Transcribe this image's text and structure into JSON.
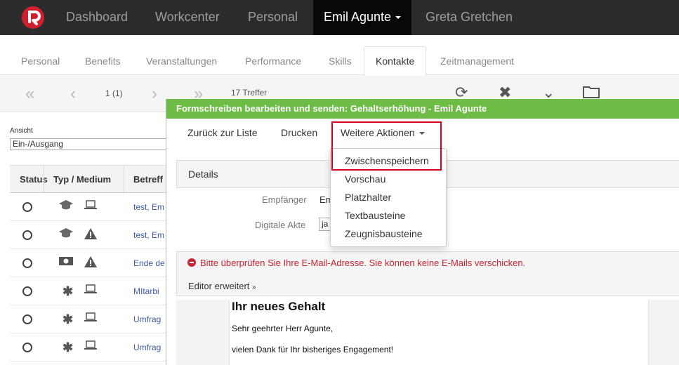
{
  "colors": {
    "topnav_bg": "#2c2c2c",
    "logo": "#d0202e",
    "modal_header": "#6cbc45",
    "error": "#c82333",
    "highlight": "#d9001b",
    "link": "#3b5ba5"
  },
  "topnav": {
    "logo": "logo-icon",
    "items": [
      "Dashboard",
      "Workcenter",
      "Personal",
      "Emil Agunte",
      "Greta Gretchen"
    ]
  },
  "tabs": [
    "Personal",
    "Benefits",
    "Veranstaltungen",
    "Performance",
    "Skills",
    "Kontakte",
    "Zeitmanagement"
  ],
  "pager": {
    "page": "1 (1)",
    "hits": "17 Treffer"
  },
  "sidebar": {
    "view_label": "Ansicht",
    "view_value": "Ein-/Ausgang"
  },
  "table": {
    "headers": [
      "Status",
      "Typ / Medium",
      "Betreff"
    ],
    "rows": [
      {
        "type_icon": "graduation-cap-icon",
        "medium_icon": "laptop-icon",
        "subject": "test, Em"
      },
      {
        "type_icon": "graduation-cap-icon",
        "medium_icon": "warning-icon",
        "subject": "test, Em"
      },
      {
        "type_icon": "money-icon",
        "medium_icon": "warning-icon",
        "subject": "Ende de"
      },
      {
        "type_icon": "asterisk-icon",
        "medium_icon": "laptop-icon",
        "subject": "MItarbi"
      },
      {
        "type_icon": "asterisk-icon",
        "medium_icon": "laptop-icon",
        "subject": "Umfrag"
      },
      {
        "type_icon": "asterisk-icon",
        "medium_icon": "laptop-icon",
        "subject": "Umfrag"
      }
    ]
  },
  "modal": {
    "title": "Formschreiben bearbeiten und senden: Gehaltserhöhung - Emil Agunte",
    "toolbar": {
      "back": "Zurück zur Liste",
      "print": "Drucken",
      "more": "Weitere Aktionen"
    },
    "dropdown": [
      "Zwischenspeichern",
      "Vorschau",
      "Platzhalter",
      "Textbausteine",
      "Zeugnisbausteine"
    ],
    "details_heading": "Details",
    "recipient_label": "Empfänger",
    "recipient_value": "Em",
    "digital_file_label": "Digitale Akte",
    "digital_file_value": "ja",
    "error": "Bitte überprüfen Sie Ihre E-Mail-Adresse. Sie können keine E-Mails verschicken.",
    "editor_toggle": "Editor erweitert",
    "letter": {
      "title": "Ihr neues Gehalt",
      "salutation": "Sehr geehrter Herr Agunte,",
      "line1": "vielen Dank für Ihr bisheriges Engagement!"
    }
  }
}
